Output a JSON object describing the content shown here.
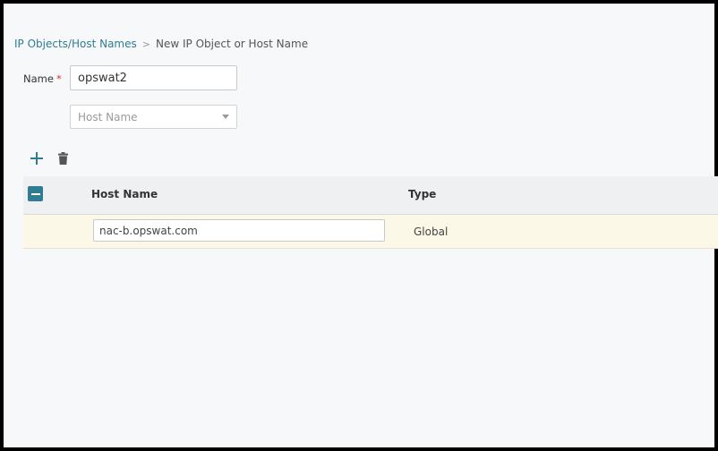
{
  "breadcrumb": {
    "parent": "IP Objects/Host Names",
    "separator": ">",
    "current": "New IP Object or Host Name"
  },
  "form": {
    "name_label": "Name",
    "required_mark": "*",
    "name_value": "opswat2",
    "type_select": {
      "selected": "Host Name"
    }
  },
  "toolbar": {
    "add_icon": "plus-icon",
    "delete_icon": "trash-icon"
  },
  "table": {
    "columns": [
      "Host Name",
      "Type"
    ],
    "rows": [
      {
        "host_name": "nac-b.opswat.com",
        "type": "Global"
      }
    ]
  },
  "colors": {
    "accent": "#2f7c93",
    "required": "#d0363b",
    "row_highlight": "#fbf8e7"
  }
}
